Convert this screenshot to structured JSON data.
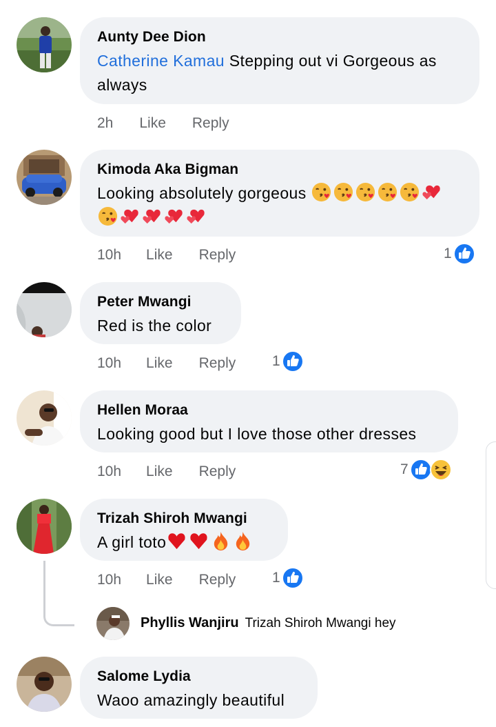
{
  "comments": [
    {
      "author": "Aunty Dee Dion",
      "mention": "Catherine Kamau",
      "text_line1": " Stepping out vi Gorgeous as",
      "text_line2": "always",
      "time": "2h",
      "like": "Like",
      "reply": "Reply"
    },
    {
      "author": "Kimoda Aka Bigman",
      "text": "Looking absolutely gorgeous ",
      "emojis_line1": [
        "kissing-heart",
        "kissing-heart",
        "kissing-heart",
        "kissing-heart",
        "kissing-heart",
        "two-hearts"
      ],
      "emojis_line2": [
        "kissing-heart",
        "two-hearts",
        "two-hearts",
        "two-hearts",
        "two-hearts"
      ],
      "time": "10h",
      "like": "Like",
      "reply": "Reply",
      "reaction_count": "1",
      "reactions": [
        "like"
      ]
    },
    {
      "author": "Peter Mwangi",
      "text": "Red is the color",
      "time": "10h",
      "like": "Like",
      "reply": "Reply",
      "reaction_count": "1",
      "reactions": [
        "like"
      ]
    },
    {
      "author": "Hellen Moraa",
      "text": "Looking good but I love those other dresses",
      "time": "10h",
      "like": "Like",
      "reply": "Reply",
      "reaction_count": "7",
      "reactions": [
        "like",
        "haha"
      ]
    },
    {
      "author": "Trizah Shiroh Mwangi",
      "text": "A girl toto",
      "emojis": [
        "red-heart",
        "red-heart",
        "fire",
        "fire"
      ],
      "time": "10h",
      "like": "Like",
      "reply": "Reply",
      "reaction_count": "1",
      "reactions": [
        "like"
      ],
      "reply_preview": {
        "author": "Phyllis Wanjiru",
        "text": "Trizah Shiroh Mwangi hey"
      }
    },
    {
      "author": "Salome Lydia",
      "text": "Waoo amazingly beautiful"
    }
  ],
  "colors": {
    "bubble": "#f0f2f5",
    "mention": "#216fdb",
    "meta": "#65676b",
    "like_blue": "#1877f2"
  }
}
